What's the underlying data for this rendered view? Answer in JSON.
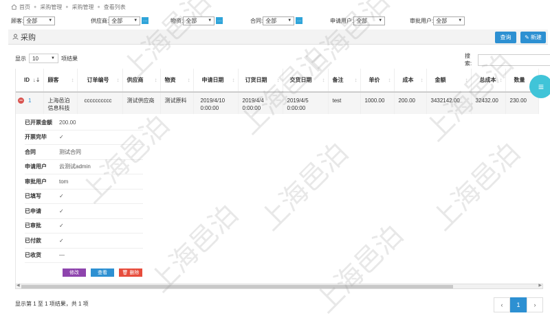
{
  "breadcrumb": {
    "items": [
      "首页",
      "采购管理",
      "采购管理",
      "查看列表"
    ]
  },
  "filters": {
    "customer": {
      "label": "顾客:",
      "value": "全部"
    },
    "supplier": {
      "label": "供应商:",
      "value": "全部"
    },
    "material": {
      "label": "物资:",
      "value": "全部"
    },
    "contract": {
      "label": "合同:",
      "value": "全部"
    },
    "applicant": {
      "label": "申请用户:",
      "value": "全部"
    },
    "approver": {
      "label": "审批用户:",
      "value": "全部"
    }
  },
  "panel": {
    "title": "采购",
    "query_label": "查询",
    "new_label": "新建"
  },
  "table_controls": {
    "show_label": "显示",
    "page_size": "10",
    "results_label": "项结果",
    "search_label": "搜索:"
  },
  "table": {
    "columns": [
      "ID",
      "顾客",
      "订单编号",
      "供应商",
      "物资",
      "申请日期",
      "订货日期",
      "交货日期",
      "备注",
      "单价",
      "成本",
      "金额",
      "总成本",
      "数量"
    ],
    "rows": [
      {
        "id": "1",
        "customer": "上海邑泊信息科技",
        "order_no": "cccccccccc",
        "supplier": "测试供应商",
        "material": "测试原料",
        "apply_date": "2019/4/10 0:00:00",
        "order_date": "2019/4/4 0:00:00",
        "delivery_date": "2019/4/5 0:00:00",
        "remark": "test",
        "unit_price": "1000.00",
        "cost": "200.00",
        "amount": "3432142.00",
        "total_cost": "32432.00",
        "quantity": "230.00"
      }
    ]
  },
  "detail": {
    "rows": [
      {
        "label": "已开票金额",
        "value": "200.00"
      },
      {
        "label": "开票完毕",
        "value": "✓"
      },
      {
        "label": "合同",
        "value": "测试合同"
      },
      {
        "label": "申请用户",
        "value": "云测试admin"
      },
      {
        "label": "审批用户",
        "value": "tom"
      },
      {
        "label": "已填写",
        "value": "✓"
      },
      {
        "label": "已申请",
        "value": "✓"
      },
      {
        "label": "已审批",
        "value": "✓"
      },
      {
        "label": "已付款",
        "value": "✓"
      },
      {
        "label": "已收货",
        "value": "—"
      }
    ],
    "edit_label": "修改",
    "view_label": "查看",
    "delete_label": "删除"
  },
  "footer": {
    "summary": "显示第 1 至 1 项结果，共 1 项",
    "prev": "‹",
    "current_page": "1",
    "next": "›"
  },
  "watermark": "上海邑泊",
  "colors": {
    "primary": "#2d90d2",
    "edit": "#8e44ad",
    "delete": "#e74c3c",
    "fab": "#40c4d8"
  }
}
